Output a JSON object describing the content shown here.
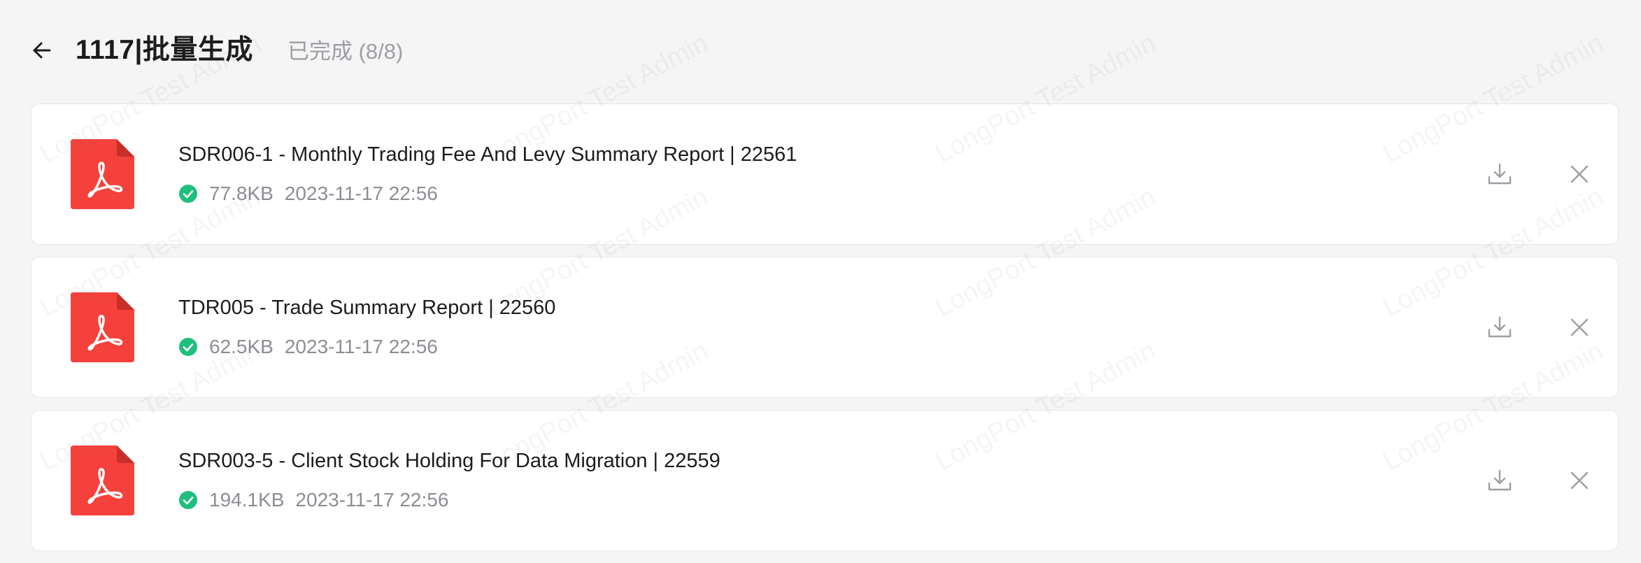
{
  "header": {
    "title": "1117|批量生成",
    "status": "已完成 (8/8)"
  },
  "watermark_text": "LongPort Test Admin",
  "colors": {
    "pdf_red": "#f5413b",
    "success_green": "#1fbf7d",
    "muted_icon": "#9b9ea3"
  },
  "files": [
    {
      "title": "SDR006-1 - Monthly Trading Fee And Levy Summary Report | 22561",
      "size": "77.8KB",
      "time": "2023-11-17 22:56",
      "icon": "pdf-file-icon"
    },
    {
      "title": "TDR005 - Trade Summary Report | 22560",
      "size": "62.5KB",
      "time": "2023-11-17 22:56",
      "icon": "pdf-file-icon"
    },
    {
      "title": "SDR003-5 - Client Stock Holding For Data Migration | 22559",
      "size": "194.1KB",
      "time": "2023-11-17 22:56",
      "icon": "pdf-file-icon"
    }
  ],
  "icons": {
    "back": "arrow-left-icon",
    "status": "check-circle-icon",
    "download": "download-icon",
    "close": "close-icon"
  }
}
